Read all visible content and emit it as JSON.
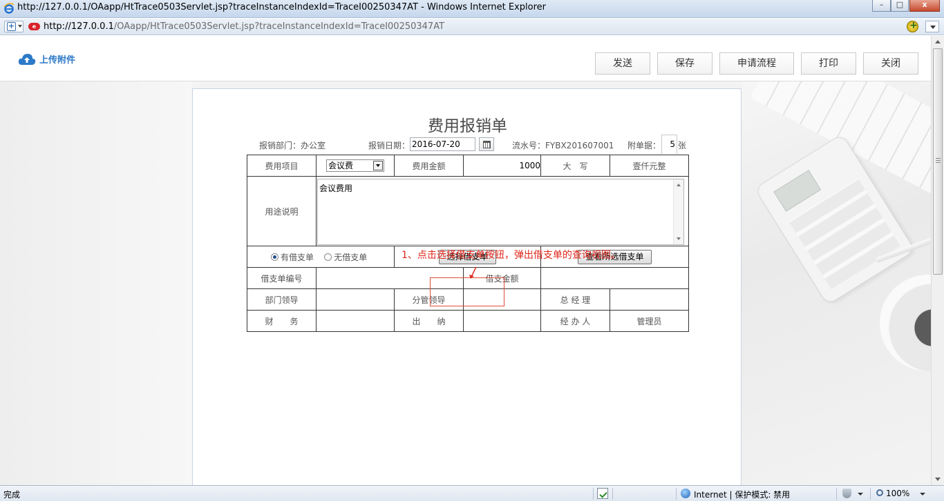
{
  "window": {
    "title": "http://127.0.0.1/OAapp/HtTrace0503Servlet.jsp?traceInstanceIndexId=TraceI00250347AT - Windows Internet Explorer",
    "minimize": "–",
    "maximize": "□",
    "close": "x"
  },
  "address": {
    "url_host": "http://127.0.0.1",
    "url_path": "/OAapp/HtTrace0503Servlet.jsp?traceInstanceIndexId=TraceI00250347AT"
  },
  "toolbar": {
    "upload_label": "上传附件",
    "buttons": [
      "发送",
      "保存",
      "申请流程",
      "打印",
      "关闭"
    ]
  },
  "form": {
    "title": "费用报销单",
    "dept_label": "报销部门：办公室",
    "date_label": "报销日期：",
    "date_value": "2016-07-20",
    "serial_label": "流水号：FYBX201607001",
    "attach_label": "附单据：",
    "attach_value": "5",
    "attach_unit": "张",
    "rows": {
      "expense_item_label": "费用项目",
      "expense_item_value": "会议费",
      "amount_label": "费用金额",
      "amount_value": "1000",
      "uppercase_label": "大　写",
      "uppercase_value": "壹仟元整",
      "purpose_label": "用途说明",
      "purpose_value": "会议费用",
      "radio_has_loan": "有借支单",
      "radio_no_loan": "无借支单",
      "select_loan_button": "选择借支单",
      "view_loan_button": "查看所选借支单",
      "loan_no_label": "借支单编号",
      "loan_amount_label": "借支金额",
      "dept_leader_label": "部门领导",
      "branch_leader_label": "分管领导",
      "gm_label": "总 经 理",
      "finance_label": "财　　务",
      "cashier_label": "出　　纳",
      "handler_label": "经 办 人",
      "admin_label": "管理员"
    }
  },
  "annotation": {
    "text": "1、点击选择借支单按钮，弹出借支单的查询视图。",
    "color": "#e0261a"
  },
  "status": {
    "left": "完成",
    "zone": "Internet | 保护模式: 禁用",
    "zoom": "100%"
  },
  "colors": {
    "accent": "#2d7ac8",
    "annotation": "#e0261a"
  }
}
